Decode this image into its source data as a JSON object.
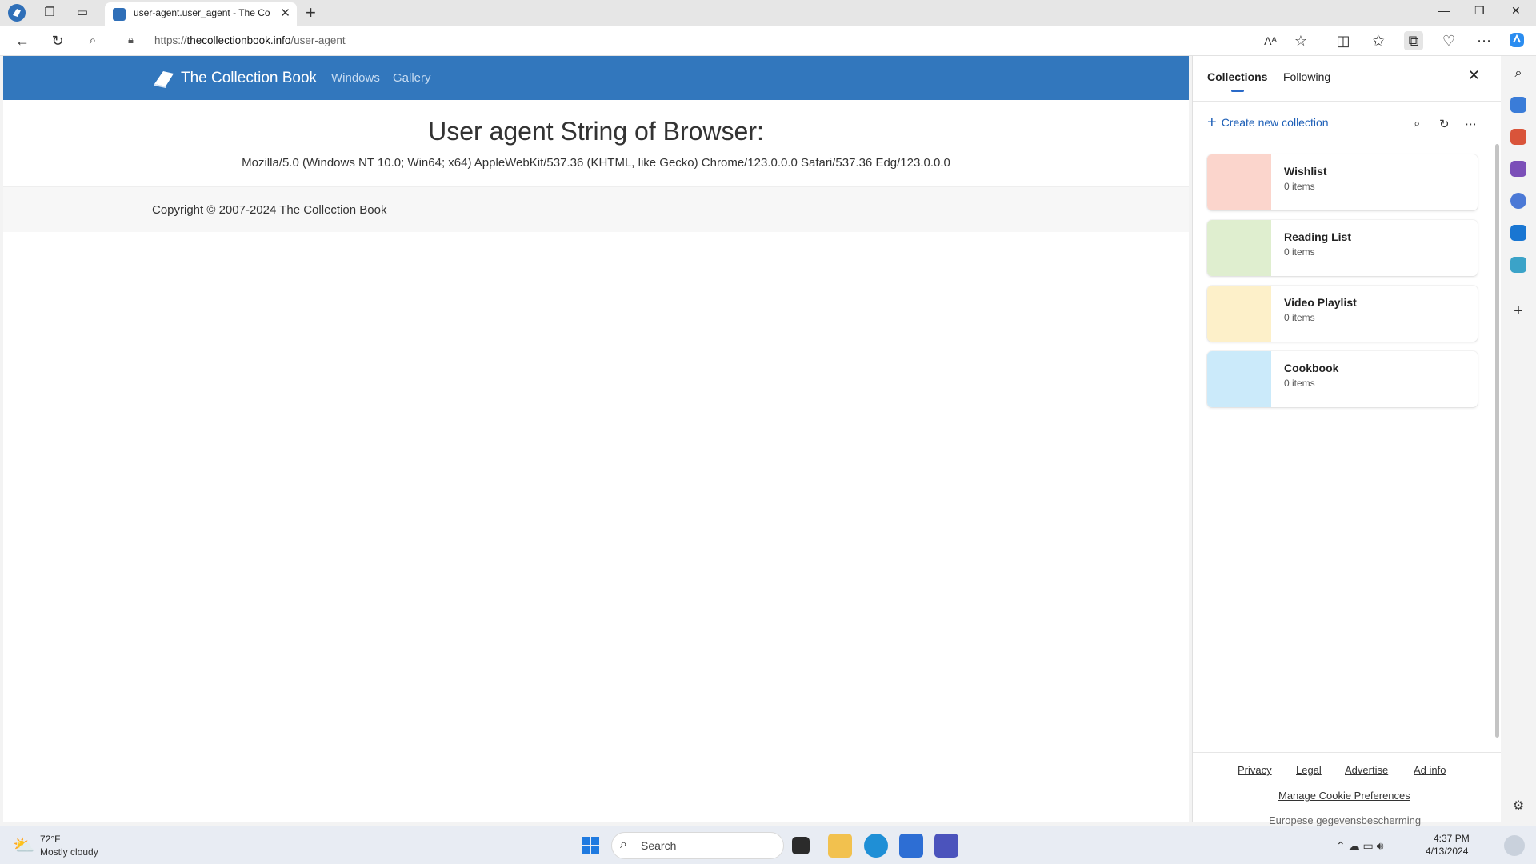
{
  "browser": {
    "tab_title": "user-agent.user_agent - The Coll",
    "url_prefix": "https://",
    "url_host": "thecollectionbook.info",
    "url_path": "/user-agent"
  },
  "site": {
    "brand": "The Collection Book",
    "nav": [
      "Windows",
      "Gallery"
    ],
    "heading": "User agent String of Browser:",
    "user_agent": "Mozilla/5.0 (Windows NT 10.0; Win64; x64) AppleWebKit/537.36 (KHTML, like Gecko) Chrome/123.0.0.0 Safari/537.36 Edg/123.0.0.0",
    "copyright": "Copyright © 2007-2024 The Collection Book"
  },
  "panel": {
    "tabs": [
      "Collections",
      "Following"
    ],
    "create_label": "Create new collection",
    "collections": [
      {
        "name": "Wishlist",
        "count": "0 items",
        "color": "#fbd5cc"
      },
      {
        "name": "Reading List",
        "count": "0 items",
        "color": "#dfeecf"
      },
      {
        "name": "Video Playlist",
        "count": "0 items",
        "color": "#fdf0c9"
      },
      {
        "name": "Cookbook",
        "count": "0 items",
        "color": "#cbeafa"
      }
    ],
    "links": [
      "Privacy",
      "Legal",
      "Advertise",
      "Ad info"
    ],
    "cookie_link": "Manage Cookie Preferences",
    "cutoff_text": "Europese gegevensbescherming"
  },
  "taskbar": {
    "weather_temp": "72°F",
    "weather_desc": "Mostly cloudy",
    "search_label": "Search",
    "time": "4:37 PM",
    "date": "4/13/2024"
  },
  "colors": {
    "brand_blue": "#3277bd",
    "accent": "#1d5fb7"
  }
}
